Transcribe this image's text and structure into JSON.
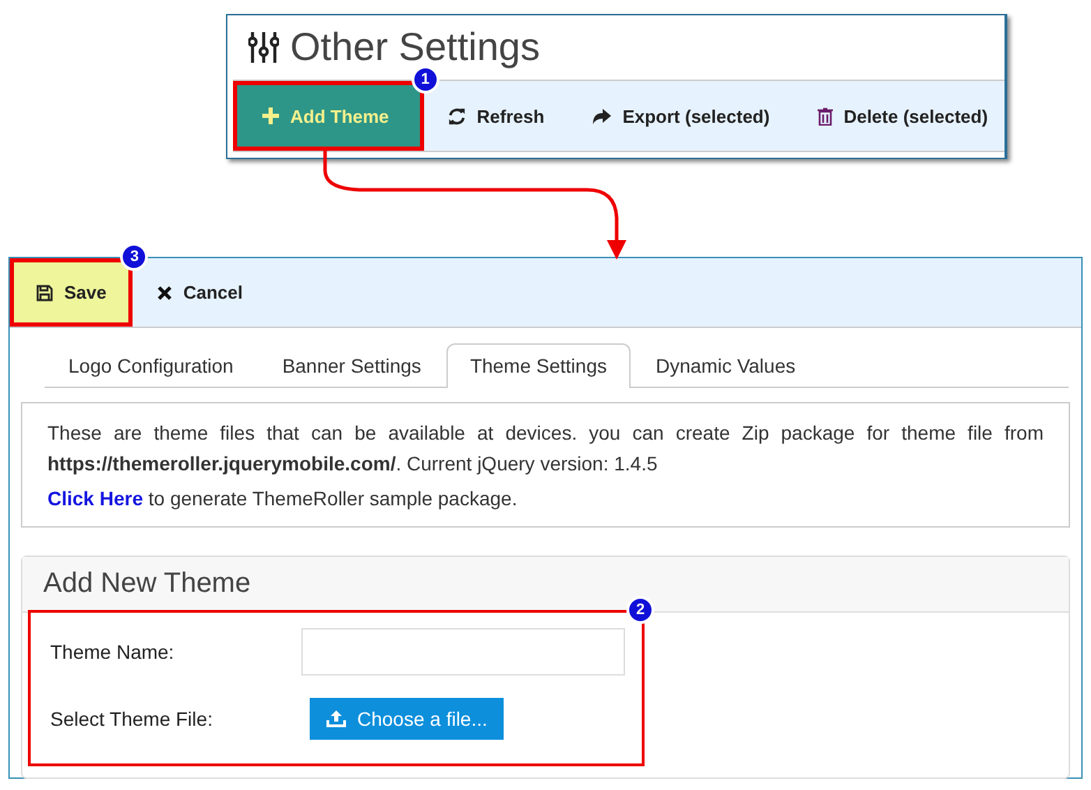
{
  "top_panel": {
    "title": "Other Settings",
    "callout": "1",
    "toolbar": [
      {
        "label": "Add Theme",
        "kind": "primary"
      },
      {
        "label": "Refresh",
        "kind": "plain"
      },
      {
        "label": "Export (selected)",
        "kind": "plain"
      },
      {
        "label": "Delete (selected)",
        "kind": "plain"
      }
    ]
  },
  "editor": {
    "callout": "3",
    "toolbar": [
      {
        "label": "Save",
        "kind": "primary"
      },
      {
        "label": "Cancel",
        "kind": "plain"
      }
    ],
    "tabs": [
      {
        "label": "Logo Configuration",
        "selected": false
      },
      {
        "label": "Banner Settings",
        "selected": false
      },
      {
        "label": "Theme Settings",
        "selected": true
      },
      {
        "label": "Dynamic Values",
        "selected": false
      }
    ],
    "info": {
      "text": "These are theme files that can be available at devices. you can create Zip package for theme file from **https://themeroller.jquerymobile.com/**. Current jQuery version: 1.4.5",
      "link": "Click Here",
      "link_text": " to generate ThemeRoller sample package."
    },
    "form": {
      "title": "Add New Theme",
      "callout": "2",
      "fields": [
        {
          "label": "Theme Name:",
          "kind": "text"
        },
        {
          "label": "Select Theme File:",
          "kind": "file",
          "button": "Choose a file..."
        }
      ]
    }
  }
}
